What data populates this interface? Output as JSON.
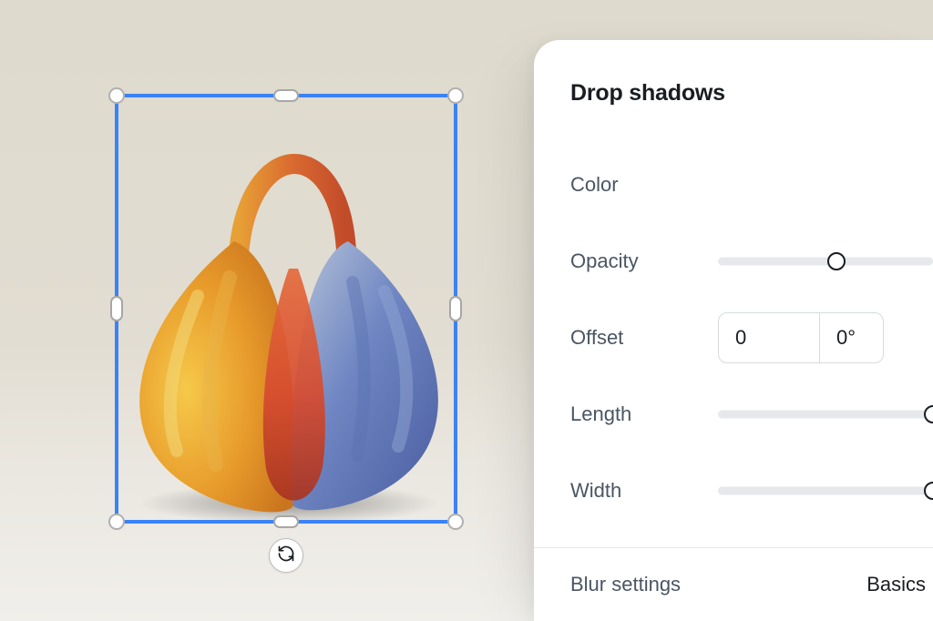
{
  "panel": {
    "title": "Drop shadows",
    "color_label": "Color",
    "opacity_label": "Opacity",
    "opacity_percent": 55,
    "offset_label": "Offset",
    "offset_value": "0",
    "offset_angle": "0°",
    "length_label": "Length",
    "length_percent": 100,
    "width_label": "Width",
    "width_percent": 100,
    "blur_section_label": "Blur settings",
    "blur_mode": "Basics"
  },
  "canvas": {
    "selected_object": "handbag-image",
    "rotate_icon": "rotate-icon"
  }
}
